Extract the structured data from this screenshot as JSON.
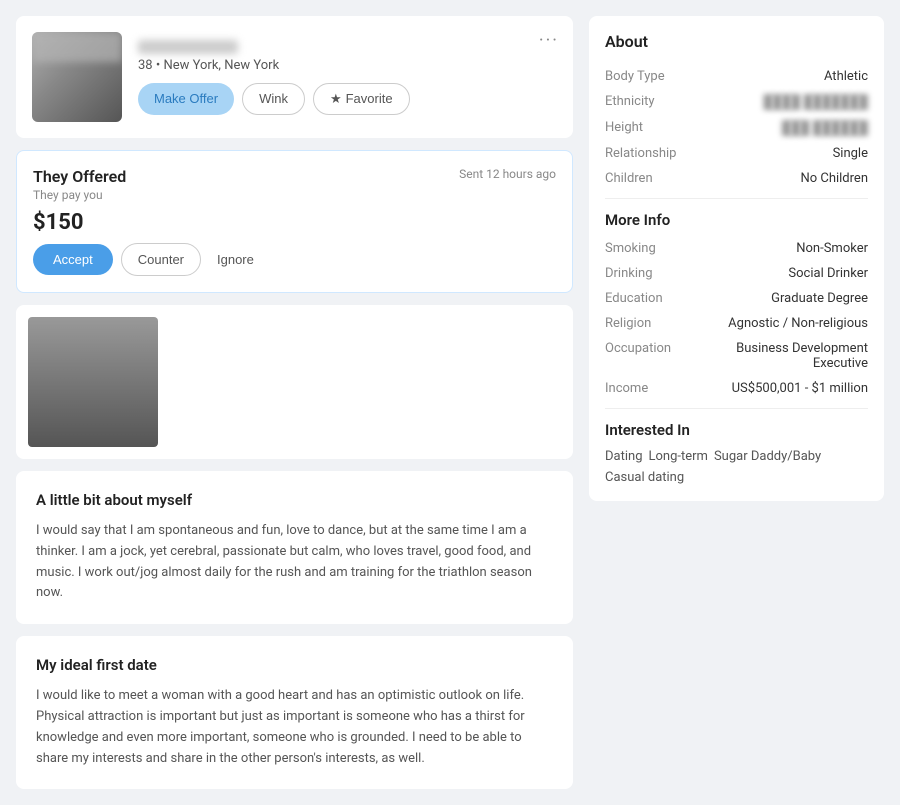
{
  "profile": {
    "name_blurred": "██████████",
    "age_location": "38 • New York, New York",
    "actions": {
      "make_offer": "Make Offer",
      "wink": "Wink",
      "favorite": "Favorite"
    }
  },
  "offer": {
    "title": "They Offered",
    "subtitle": "They pay you",
    "amount": "$150",
    "sent_time": "Sent 12 hours ago",
    "actions": {
      "accept": "Accept",
      "counter": "Counter",
      "ignore": "Ignore"
    }
  },
  "about_section": {
    "title": "A little bit about myself",
    "body": "I would say that I am spontaneous and fun, love to dance, but at the same time I am a thinker. I am a jock, yet cerebral, passionate but calm, who loves travel, good food, and music. I work out/jog almost daily for the rush and am training for the triathlon season now."
  },
  "ideal_date_section": {
    "title": "My ideal first date",
    "body": "I would like to meet a woman with a good heart and has an optimistic outlook on life. Physical attraction is important but just as important is someone who has a thirst for knowledge and even more important, someone who is grounded. I need to be able to share my interests and share in the other person's interests, as well."
  },
  "right_panel": {
    "about_title": "About",
    "body_type_label": "Body Type",
    "body_type_value": "Athletic",
    "ethnicity_label": "Ethnicity",
    "ethnicity_value": "████ ███████",
    "height_label": "Height",
    "height_value": "███ ██████",
    "relationship_label": "Relationship",
    "relationship_value": "Single",
    "children_label": "Children",
    "children_value": "No Children",
    "more_info_title": "More Info",
    "smoking_label": "Smoking",
    "smoking_value": "Non-Smoker",
    "drinking_label": "Drinking",
    "drinking_value": "Social Drinker",
    "education_label": "Education",
    "education_value": "Graduate Degree",
    "religion_label": "Religion",
    "religion_value": "Agnostic / Non-religious",
    "occupation_label": "Occupation",
    "occupation_value": "Business Development Executive",
    "income_label": "Income",
    "income_value": "US$500,001 - $1 million",
    "interested_in_title": "Interested In",
    "interested_tags": [
      "Dating",
      "Long-term",
      "Sugar Daddy/Baby",
      "Casual dating"
    ]
  }
}
